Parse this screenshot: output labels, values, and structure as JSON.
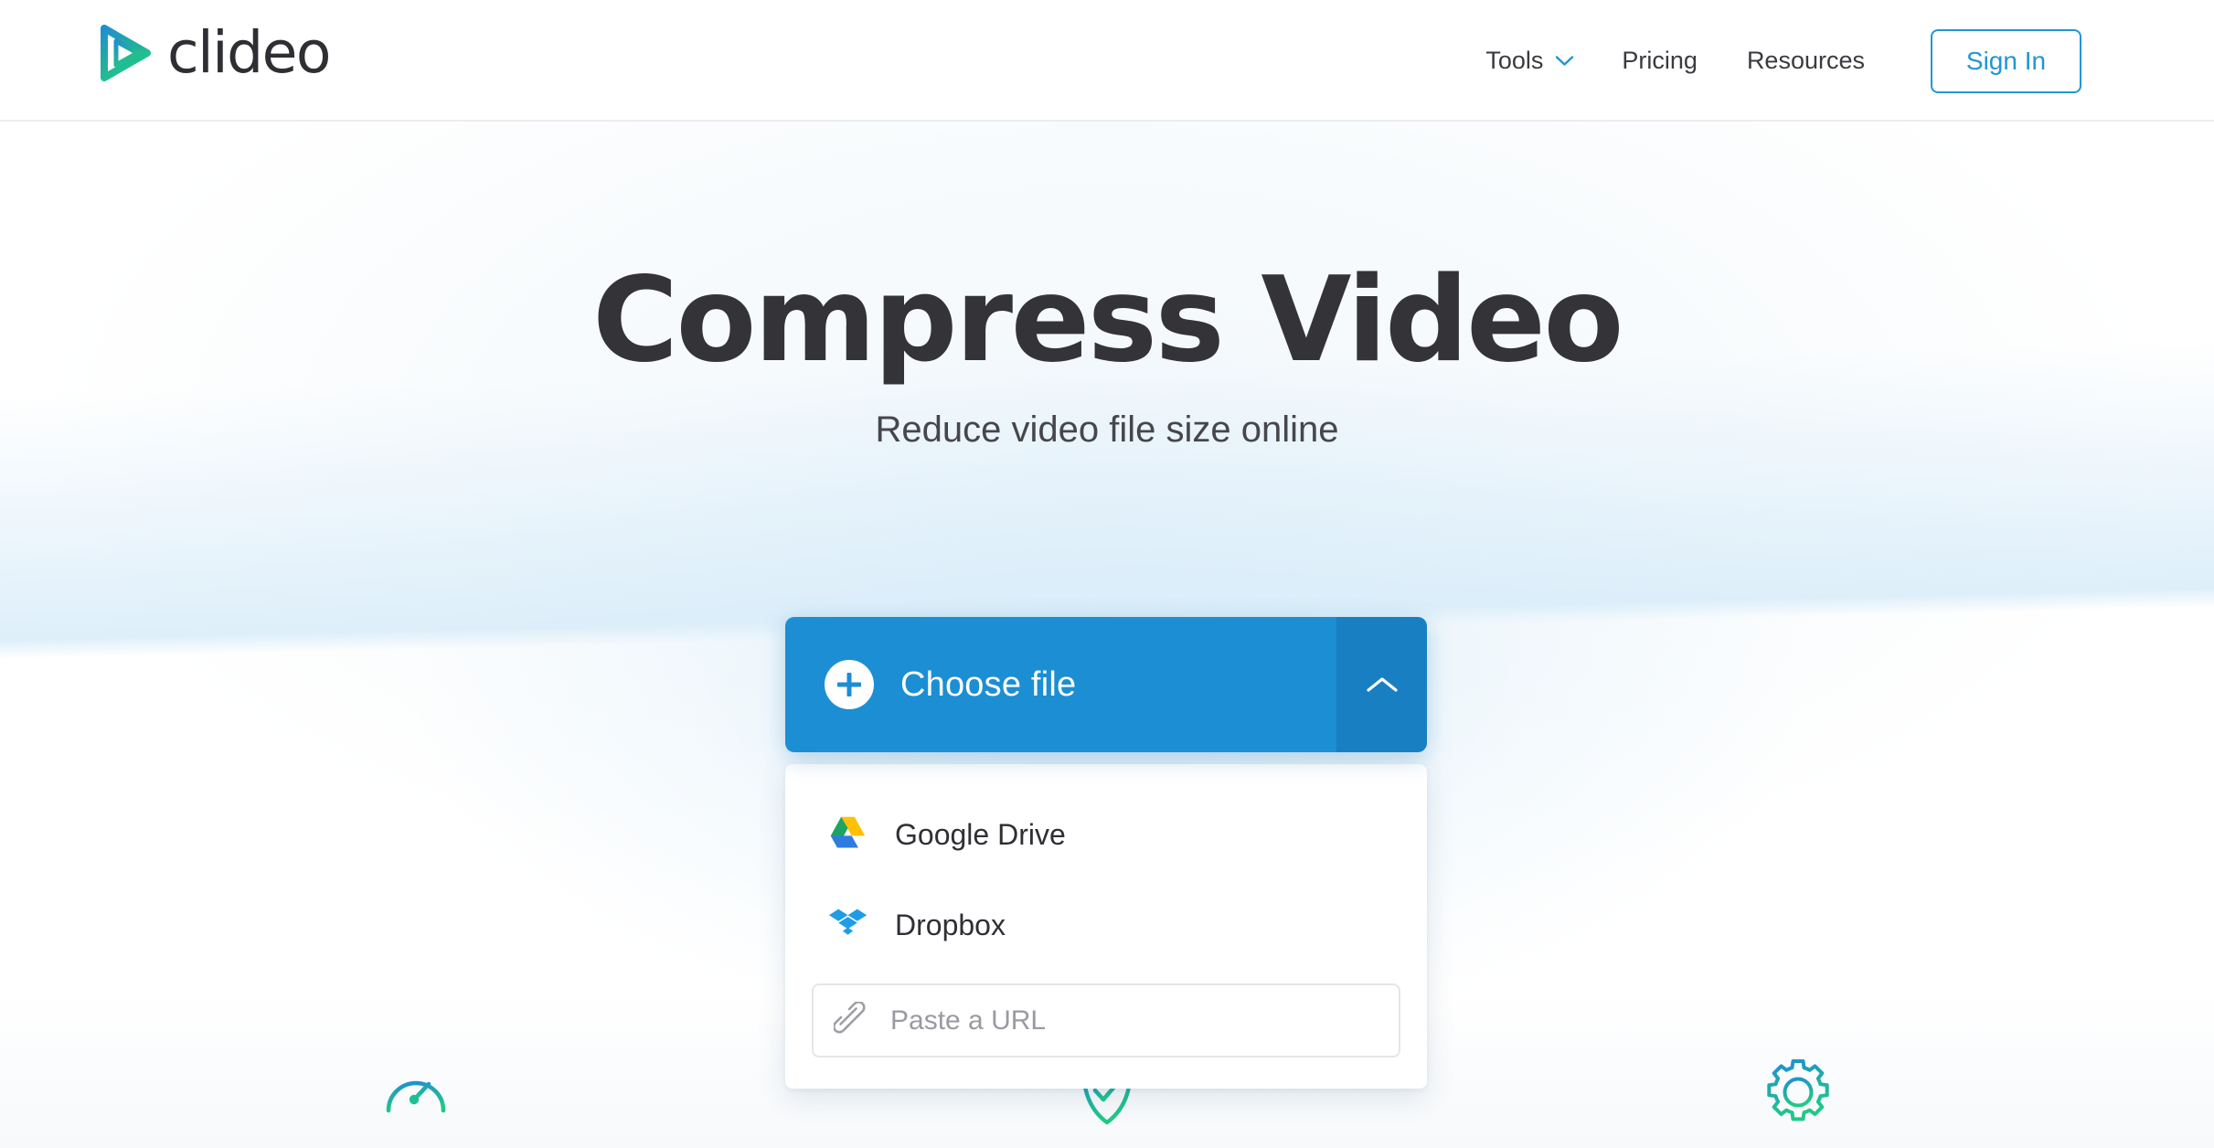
{
  "header": {
    "logo": {
      "brand": "clideo",
      "mark_icon": "play-triangle-icon",
      "gradient_from": "#1f8fd0",
      "gradient_to": "#1fc48b"
    },
    "nav": [
      {
        "label": "Tools",
        "icon": "chevron-down-icon",
        "has_dropdown": true
      },
      {
        "label": "Pricing",
        "has_dropdown": false
      },
      {
        "label": "Resources",
        "has_dropdown": false
      }
    ],
    "signin_label": "Sign In",
    "accent_color": "#2196d6"
  },
  "hero": {
    "title": "Compress Video",
    "subtitle": "Reduce video file size online",
    "title_color": "#333338",
    "background_color": "#ffffff",
    "band_color": "#d8ecf9"
  },
  "uploader": {
    "choose": {
      "label": "Choose file",
      "icon": "plus-circle-icon",
      "background": "#1c8ed4",
      "text_color": "#ffffff"
    },
    "toggle": {
      "icon": "chevron-up-icon",
      "state": "expanded",
      "background": "#1880c2"
    },
    "dropdown": {
      "expanded": true,
      "items": [
        {
          "label": "Google Drive",
          "icon": "google-drive-icon"
        },
        {
          "label": "Dropbox",
          "icon": "dropbox-icon"
        }
      ],
      "url_field": {
        "placeholder": "Paste a URL",
        "value": "",
        "icon": "link-icon"
      }
    }
  },
  "features": [
    {
      "name": "speed",
      "icon": "speedometer-icon"
    },
    {
      "name": "secure",
      "icon": "shield-check-icon"
    },
    {
      "name": "settings",
      "icon": "gear-icon"
    }
  ],
  "icon_gradient": {
    "from": "#1f8fd0",
    "to": "#1fc48b"
  }
}
